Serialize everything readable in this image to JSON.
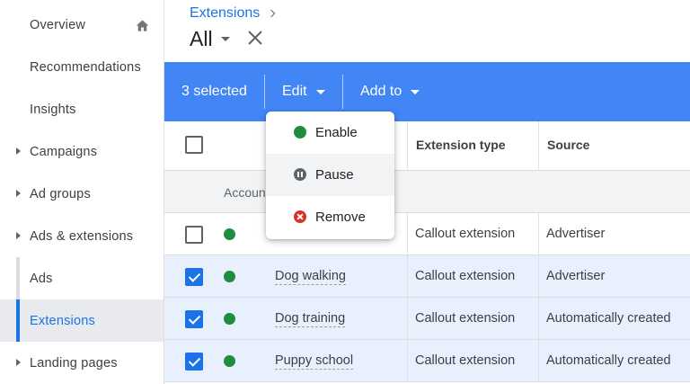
{
  "sidebar": {
    "items": [
      {
        "label": "Overview",
        "icon": "home-icon"
      },
      {
        "label": "Recommendations"
      },
      {
        "label": "Insights"
      },
      {
        "label": "Campaigns",
        "expandable": true
      },
      {
        "label": "Ad groups",
        "expandable": true
      },
      {
        "label": "Ads & extensions",
        "expandable": true
      },
      {
        "label": "Ads"
      },
      {
        "label": "Extensions",
        "active": true
      },
      {
        "label": "Landing pages",
        "expandable": true
      }
    ]
  },
  "header": {
    "breadcrumb": "Extensions",
    "view_title": "All"
  },
  "action_bar": {
    "selected_text": "3 selected",
    "edit_label": "Edit",
    "add_to_label": "Add to",
    "color": "#4285f4"
  },
  "menu": {
    "items": [
      {
        "label": "Enable",
        "icon": "enable-dot-icon",
        "color": "#1e8e3e"
      },
      {
        "label": "Pause",
        "icon": "pause-icon",
        "color": "#5f6368"
      },
      {
        "label": "Remove",
        "icon": "remove-icon",
        "color": "#d93025"
      }
    ]
  },
  "table": {
    "columns": [
      "Extension type",
      "Source"
    ],
    "group_label": "Accoun",
    "rows": [
      {
        "extension": "",
        "type": "Callout extension",
        "source": "Advertiser",
        "checked": false
      },
      {
        "extension": "Dog walking",
        "type": "Callout extension",
        "source": "Advertiser",
        "checked": true
      },
      {
        "extension": "Dog training",
        "type": "Callout extension",
        "source": "Automatically created",
        "checked": true
      },
      {
        "extension": "Puppy school",
        "type": "Callout extension",
        "source": "Automatically created",
        "checked": true
      }
    ]
  }
}
